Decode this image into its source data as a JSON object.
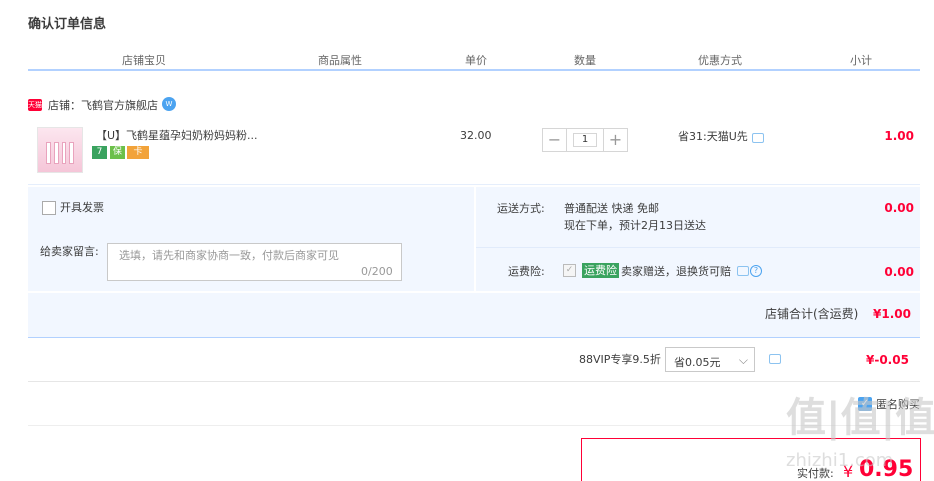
{
  "page_title": "确认订单信息",
  "columns": [
    "店铺宝贝",
    "商品属性",
    "单价",
    "数量",
    "优惠方式",
    "小计"
  ],
  "store": {
    "badge": "天猫",
    "label": "店铺：飞鹤官方旗舰店"
  },
  "product": {
    "title": "【U】飞鹤星蕴孕妇奶粉妈妈粉...",
    "service_icons": [
      "7",
      "保",
      "卡"
    ],
    "price": "32.00",
    "quantity": "1",
    "minus": "−",
    "plus": "+",
    "promo": "省31:天猫U先",
    "subtotal": "1.00"
  },
  "invoice": {
    "label": "开具发票"
  },
  "message": {
    "label": "给卖家留言:",
    "placeholder": "选填，请先和商家协商一致，付款后商家可见",
    "count": "0/200"
  },
  "shipping": {
    "label": "运送方式:",
    "line1": "普通配送 快递 免邮",
    "line2": "现在下单，预计2月13日送达",
    "price": "0.00"
  },
  "insurance": {
    "label": "运费险:",
    "check": "✓",
    "tag": "运费险",
    "desc": "卖家赠送，退换货可赔",
    "help": "?",
    "price": "0.00"
  },
  "store_total": {
    "label": "店铺合计(含运费)",
    "value": "¥1.00"
  },
  "vip": {
    "label": "88VIP专享9.5折",
    "selected": "省0.05元",
    "arrow": "⌵",
    "value": "¥-0.05"
  },
  "anonymous": {
    "check": "✓",
    "label": "匿名购买"
  },
  "payment": {
    "label": "实付款:",
    "currency": "¥",
    "amount": "0.95"
  },
  "watermark": {
    "text": "值|值|值",
    "url": "zhizhi1.com"
  },
  "colors": {
    "accent_red": "#ff0036",
    "panel_bg": "#f2f7ff",
    "header_line": "#b2d1ff",
    "link_blue": "#4ba3f0",
    "insurance_green": "#3aa35f"
  }
}
